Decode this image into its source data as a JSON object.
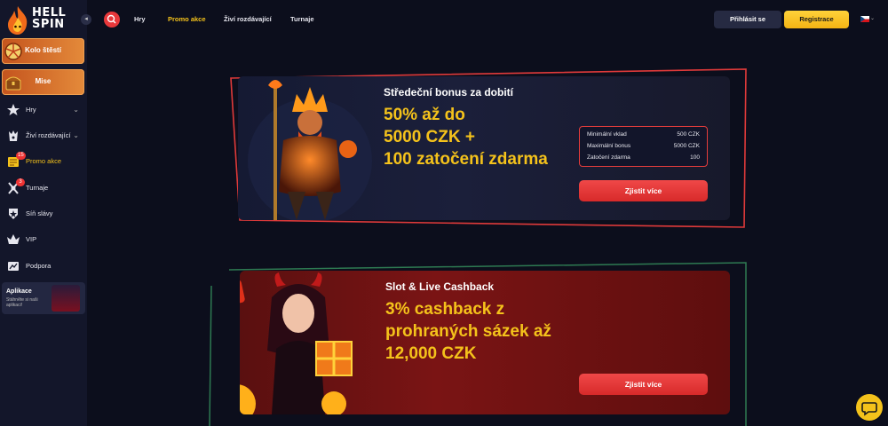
{
  "brand": {
    "logo_line1": "HELL",
    "logo_line2": "SPIN",
    "accent": "#f4c21b",
    "primary_red": "#e8383b"
  },
  "sidebar": {
    "collapse_glyph": "◂",
    "promo_tiles": [
      {
        "label": "Kolo štěstí",
        "icon": "fortune-wheel-icon"
      },
      {
        "label": "Mise",
        "icon": "treasure-chest-icon"
      }
    ],
    "items": [
      {
        "label": "Hry",
        "icon": "games-icon",
        "chevron": "⌄"
      },
      {
        "label": "Živí rozdávající",
        "icon": "live-dealer-icon",
        "chevron": "⌄"
      },
      {
        "label": "Promo akce",
        "icon": "promo-scroll-icon",
        "badge": "15",
        "active": true
      },
      {
        "label": "Turnaje",
        "icon": "tournament-icon",
        "badge": "3"
      },
      {
        "label": "Síň slávy",
        "icon": "hall-of-fame-icon"
      },
      {
        "label": "VIP",
        "icon": "crown-icon"
      },
      {
        "label": "Podpora",
        "icon": "support-icon"
      }
    ],
    "app": {
      "title": "Aplikace",
      "subtitle": "Stáhněte si naši aplikaci!"
    }
  },
  "topbar": {
    "nav": [
      {
        "label": "Hry",
        "active": false
      },
      {
        "label": "Promo akce",
        "active": true
      },
      {
        "label": "Živí rozdávající",
        "active": false
      },
      {
        "label": "Turnaje",
        "active": false
      }
    ],
    "login_label": "Přihlásit se",
    "register_label": "Registrace",
    "language": "CZ",
    "language_chevron": "⌄"
  },
  "promos": [
    {
      "title": "Středeční bonus za dobití",
      "headline": [
        "50% až do",
        "5000 CZK +",
        "100 zatočení zdarma"
      ],
      "details": [
        {
          "label": "Minimální vklad",
          "value": "500 CZK"
        },
        {
          "label": "Maximální bonus",
          "value": "5000 CZK"
        },
        {
          "label": "Zatočení zdarma",
          "value": "100"
        }
      ],
      "cta_label": "Zjistit více"
    },
    {
      "title": "Slot & Live Cashback",
      "headline": [
        "3% cashback z",
        "prohraných sázek až",
        "12,000 CZK"
      ],
      "cta_label": "Zjistit více"
    }
  ]
}
